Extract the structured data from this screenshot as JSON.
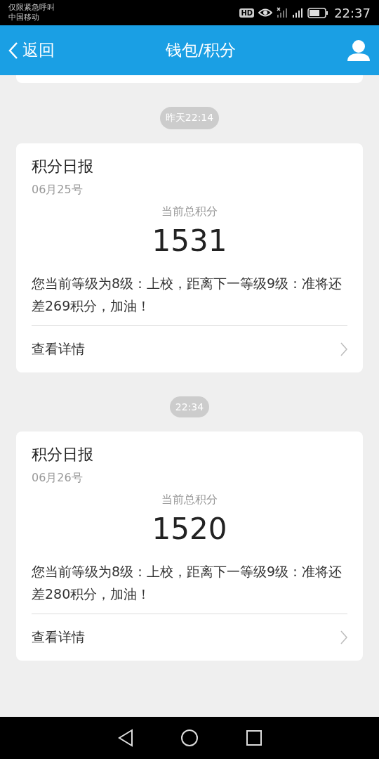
{
  "status_bar": {
    "carrier_lines": [
      "仅限紧急呼叫",
      "中国移动"
    ],
    "hd_badge": "HD",
    "time": "22:37"
  },
  "header": {
    "back": "返回",
    "title": "钱包/积分"
  },
  "messages": [
    {
      "time": "昨天22:14",
      "title": "积分日报",
      "date": "06月25号",
      "points_label": "当前总积分",
      "points": "1531",
      "text": "您当前等级为8级：上校，距离下一等级9级：准将还差269积分，加油！",
      "link": "查看详情"
    },
    {
      "time": "22:34",
      "title": "积分日报",
      "date": "06月26号",
      "points_label": "当前总积分",
      "points": "1520",
      "text": "您当前等级为8级：上校，距离下一等级9级：准将还差280积分，加油！",
      "link": "查看详情"
    }
  ]
}
